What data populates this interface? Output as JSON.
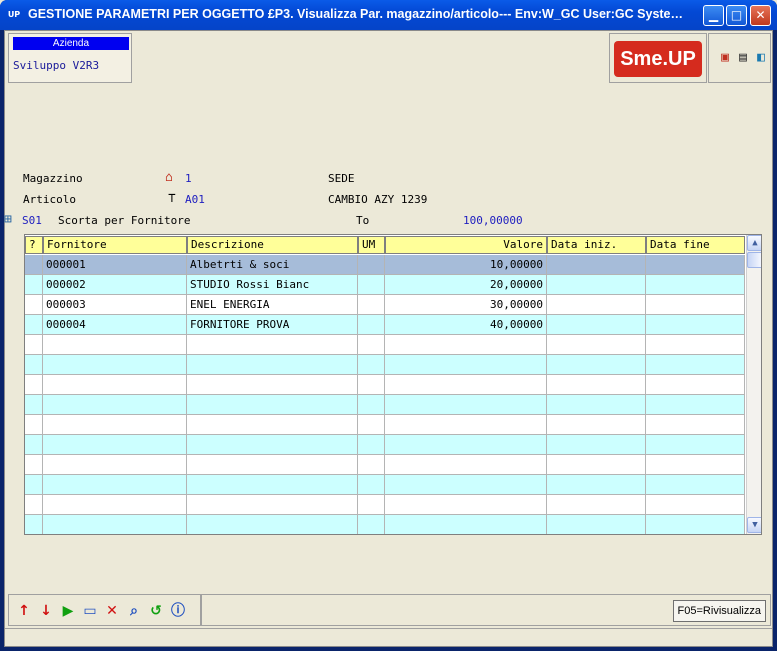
{
  "window": {
    "icon_text": "UP",
    "title": "GESTIONE PARAMETRI PER OGGETTO £P3.  Visualizza Par. magazzino/articolo--- Env:W_GC User:GC Syste…"
  },
  "azienda": {
    "header": "Azienda",
    "value": "Sviluppo V2R3"
  },
  "logo": {
    "text": "Sme.UP",
    "color": "#D52B1E"
  },
  "fields": {
    "magazzino": {
      "label": "Magazzino",
      "code": "1",
      "desc": "SEDE"
    },
    "articolo": {
      "label": "Articolo",
      "code": "A01",
      "desc": "CAMBIO AZY 1239"
    },
    "scorta": {
      "code": "S01",
      "label": "Scorta per Fornitore",
      "to_label": "To",
      "to_value": "100,00000"
    }
  },
  "table": {
    "columns": [
      "?",
      "Fornitore",
      "Descrizione",
      "UM",
      "Valore",
      "Data iniz.",
      "Data fine"
    ],
    "rows": [
      {
        "fornitore": "000001",
        "descrizione": "Albetrti & soci",
        "um": "",
        "valore": "10,00000",
        "data_iniz": "",
        "data_fine": ""
      },
      {
        "fornitore": "000002",
        "descrizione": "STUDIO Rossi Bianc",
        "um": "",
        "valore": "20,00000",
        "data_iniz": "",
        "data_fine": ""
      },
      {
        "fornitore": "000003",
        "descrizione": "ENEL ENERGIA",
        "um": "",
        "valore": "30,00000",
        "data_iniz": "",
        "data_fine": ""
      },
      {
        "fornitore": "000004",
        "descrizione": "FORNITORE PROVA",
        "um": "",
        "valore": "40,00000",
        "data_iniz": "",
        "data_fine": ""
      }
    ],
    "selected_row_color": "#A6BCD9",
    "alt_row_color": "#CCFFFF"
  },
  "toolbar": {
    "icons": [
      "arrow-up-icon",
      "arrow-down-icon",
      "play-icon",
      "window-icon",
      "delete-icon",
      "search-icon",
      "refresh-icon",
      "info-icon"
    ]
  },
  "f05_button": "F05=Rivisualizza"
}
